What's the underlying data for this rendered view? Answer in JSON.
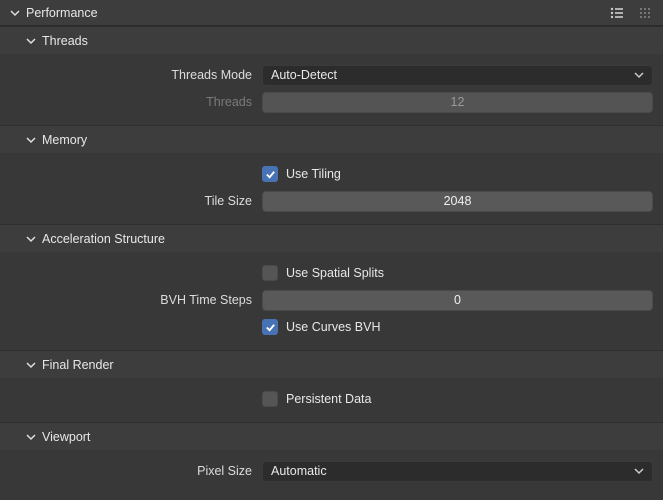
{
  "panel": {
    "title": "Performance"
  },
  "sections": {
    "threads": {
      "title": "Threads",
      "threadsModeLabel": "Threads Mode",
      "threadsModeValue": "Auto-Detect",
      "threadsLabel": "Threads",
      "threadsValue": "12"
    },
    "memory": {
      "title": "Memory",
      "useTilingLabel": "Use Tiling",
      "useTilingChecked": true,
      "tileSizeLabel": "Tile Size",
      "tileSizeValue": "2048"
    },
    "accel": {
      "title": "Acceleration Structure",
      "useSpatialSplitsLabel": "Use Spatial Splits",
      "useSpatialSplitsChecked": false,
      "bvhTimeStepsLabel": "BVH Time Steps",
      "bvhTimeStepsValue": "0",
      "useCurvesBvhLabel": "Use Curves BVH",
      "useCurvesBvhChecked": true
    },
    "final": {
      "title": "Final Render",
      "persistentDataLabel": "Persistent Data",
      "persistentDataChecked": false
    },
    "viewport": {
      "title": "Viewport",
      "pixelSizeLabel": "Pixel Size",
      "pixelSizeValue": "Automatic"
    }
  }
}
